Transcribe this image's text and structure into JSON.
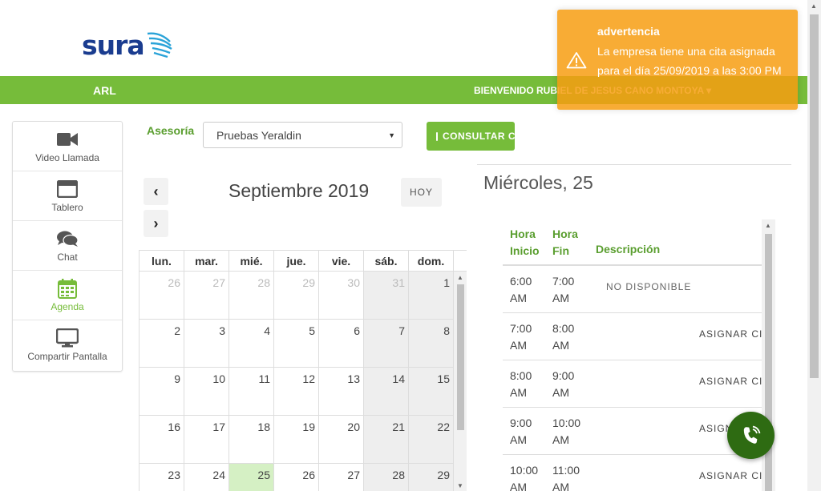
{
  "header": {
    "logo_text": "sura",
    "nav_left": "ARL",
    "welcome": "BIENVENIDO RUBIEL DE JESUS CANO MONTOYA ▾",
    "brand_color": "#76bc3a"
  },
  "sidebar": {
    "items": [
      {
        "label": "Video Llamada",
        "icon": "video-camera-icon"
      },
      {
        "label": "Tablero",
        "icon": "window-icon"
      },
      {
        "label": "Chat",
        "icon": "chat-bubbles-icon"
      },
      {
        "label": "Agenda",
        "icon": "calendar-icon",
        "active": true
      },
      {
        "label": "Compartir Pantalla",
        "icon": "monitor-icon"
      }
    ]
  },
  "filter": {
    "label": "Asesoría",
    "selected": "Pruebas Yeraldin",
    "consultar_label": "CONSULTAR C"
  },
  "calendar": {
    "month_title": "Septiembre 2019",
    "today_label": "HOY",
    "weekdays": [
      "lun.",
      "mar.",
      "mié.",
      "jue.",
      "vie.",
      "sáb.",
      "dom."
    ],
    "weeks": [
      [
        "26",
        "27",
        "28",
        "29",
        "30",
        "31",
        "1"
      ],
      [
        "2",
        "3",
        "4",
        "5",
        "6",
        "7",
        "8"
      ],
      [
        "9",
        "10",
        "11",
        "12",
        "13",
        "14",
        "15"
      ],
      [
        "16",
        "17",
        "18",
        "19",
        "20",
        "21",
        "22"
      ],
      [
        "23",
        "24",
        "25",
        "26",
        "27",
        "28",
        "29"
      ]
    ]
  },
  "day": {
    "title": "Miércoles, 25",
    "col_start": "Hora Inicio",
    "col_end": "Hora Fin",
    "col_desc": "Descripción",
    "col_start_l1": "Hora",
    "col_start_l2": "Inicio",
    "col_end_l1": "Hora",
    "col_end_l2": "Fin",
    "slots": [
      {
        "start_l1": "6:00",
        "start_l2": "AM",
        "end_l1": "7:00",
        "end_l2": "AM",
        "status": "NO DISPONIBLE",
        "action": ""
      },
      {
        "start_l1": "7:00",
        "start_l2": "AM",
        "end_l1": "8:00",
        "end_l2": "AM",
        "status": "",
        "action": "ASIGNAR CITA"
      },
      {
        "start_l1": "8:00",
        "start_l2": "AM",
        "end_l1": "9:00",
        "end_l2": "AM",
        "status": "",
        "action": "ASIGNAR CITA"
      },
      {
        "start_l1": "9:00",
        "start_l2": "AM",
        "end_l1": "10:00",
        "end_l2": "AM",
        "status": "",
        "action": "ASIGNAR CITA"
      },
      {
        "start_l1": "10:00",
        "start_l2": "AM",
        "end_l1": "11:00",
        "end_l2": "AM",
        "status": "",
        "action": "ASIGNAR CITA"
      }
    ]
  },
  "toast": {
    "title": "advertencia",
    "message": "La empresa tiene una cita asignada para el día 25/09/2019 a las 3:00 PM",
    "color": "#f79d12"
  }
}
